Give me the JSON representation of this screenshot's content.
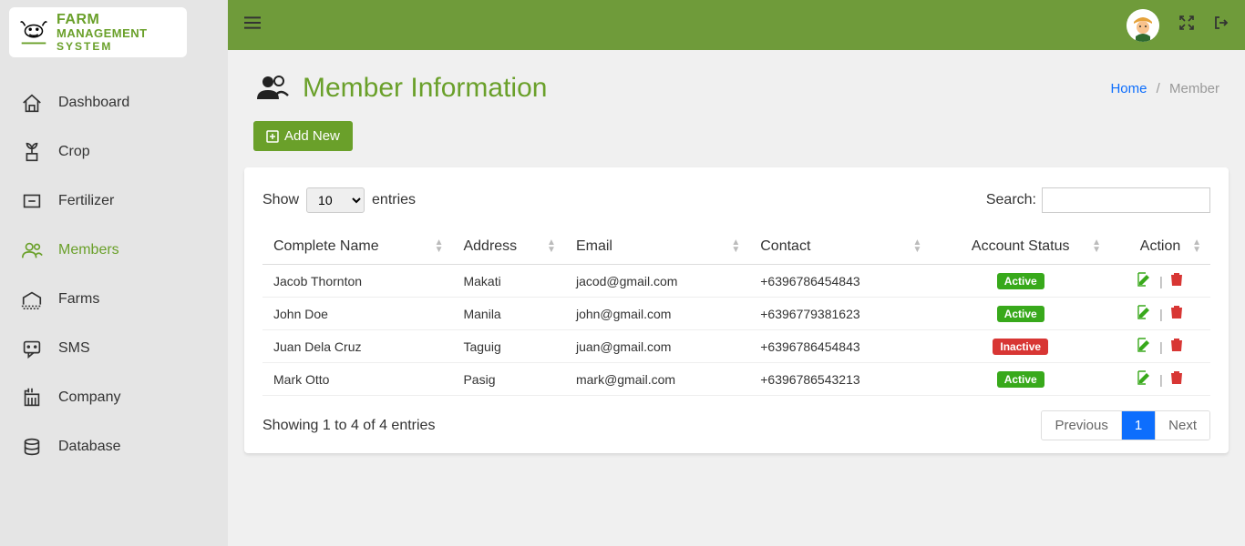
{
  "brand": {
    "line1": "FARM",
    "line2": "MANAGEMENT",
    "line3": "SYSTEM"
  },
  "sidebar": {
    "items": [
      {
        "label": "Dashboard",
        "icon": "home-icon"
      },
      {
        "label": "Crop",
        "icon": "plant-icon"
      },
      {
        "label": "Fertilizer",
        "icon": "box-icon"
      },
      {
        "label": "Members",
        "icon": "members-icon",
        "active": true
      },
      {
        "label": "Farms",
        "icon": "farm-icon"
      },
      {
        "label": "SMS",
        "icon": "chat-icon"
      },
      {
        "label": "Company",
        "icon": "building-icon"
      },
      {
        "label": "Database",
        "icon": "database-icon"
      }
    ]
  },
  "header": {
    "title": "Member Information",
    "breadcrumb_home": "Home",
    "breadcrumb_current": "Member"
  },
  "buttons": {
    "add_new": "Add New"
  },
  "table": {
    "show_label_pre": "Show",
    "show_label_post": "entries",
    "length_value": "10",
    "search_label": "Search:",
    "columns": [
      "Complete Name",
      "Address",
      "Email",
      "Contact",
      "Account Status",
      "Action"
    ],
    "rows": [
      {
        "name": "Jacob Thornton",
        "address": "Makati",
        "email": "jacod@gmail.com",
        "contact": "+6396786454843",
        "status": "Active"
      },
      {
        "name": "John Doe",
        "address": "Manila",
        "email": "john@gmail.com",
        "contact": "+6396779381623",
        "status": "Active"
      },
      {
        "name": "Juan Dela Cruz",
        "address": "Taguig",
        "email": "juan@gmail.com",
        "contact": "+6396786454843",
        "status": "Inactive"
      },
      {
        "name": "Mark Otto",
        "address": "Pasig",
        "email": "mark@gmail.com",
        "contact": "+6396786543213",
        "status": "Active"
      }
    ],
    "info": "Showing 1 to 4 of 4 entries",
    "prev": "Previous",
    "next": "Next",
    "current_page": "1"
  }
}
